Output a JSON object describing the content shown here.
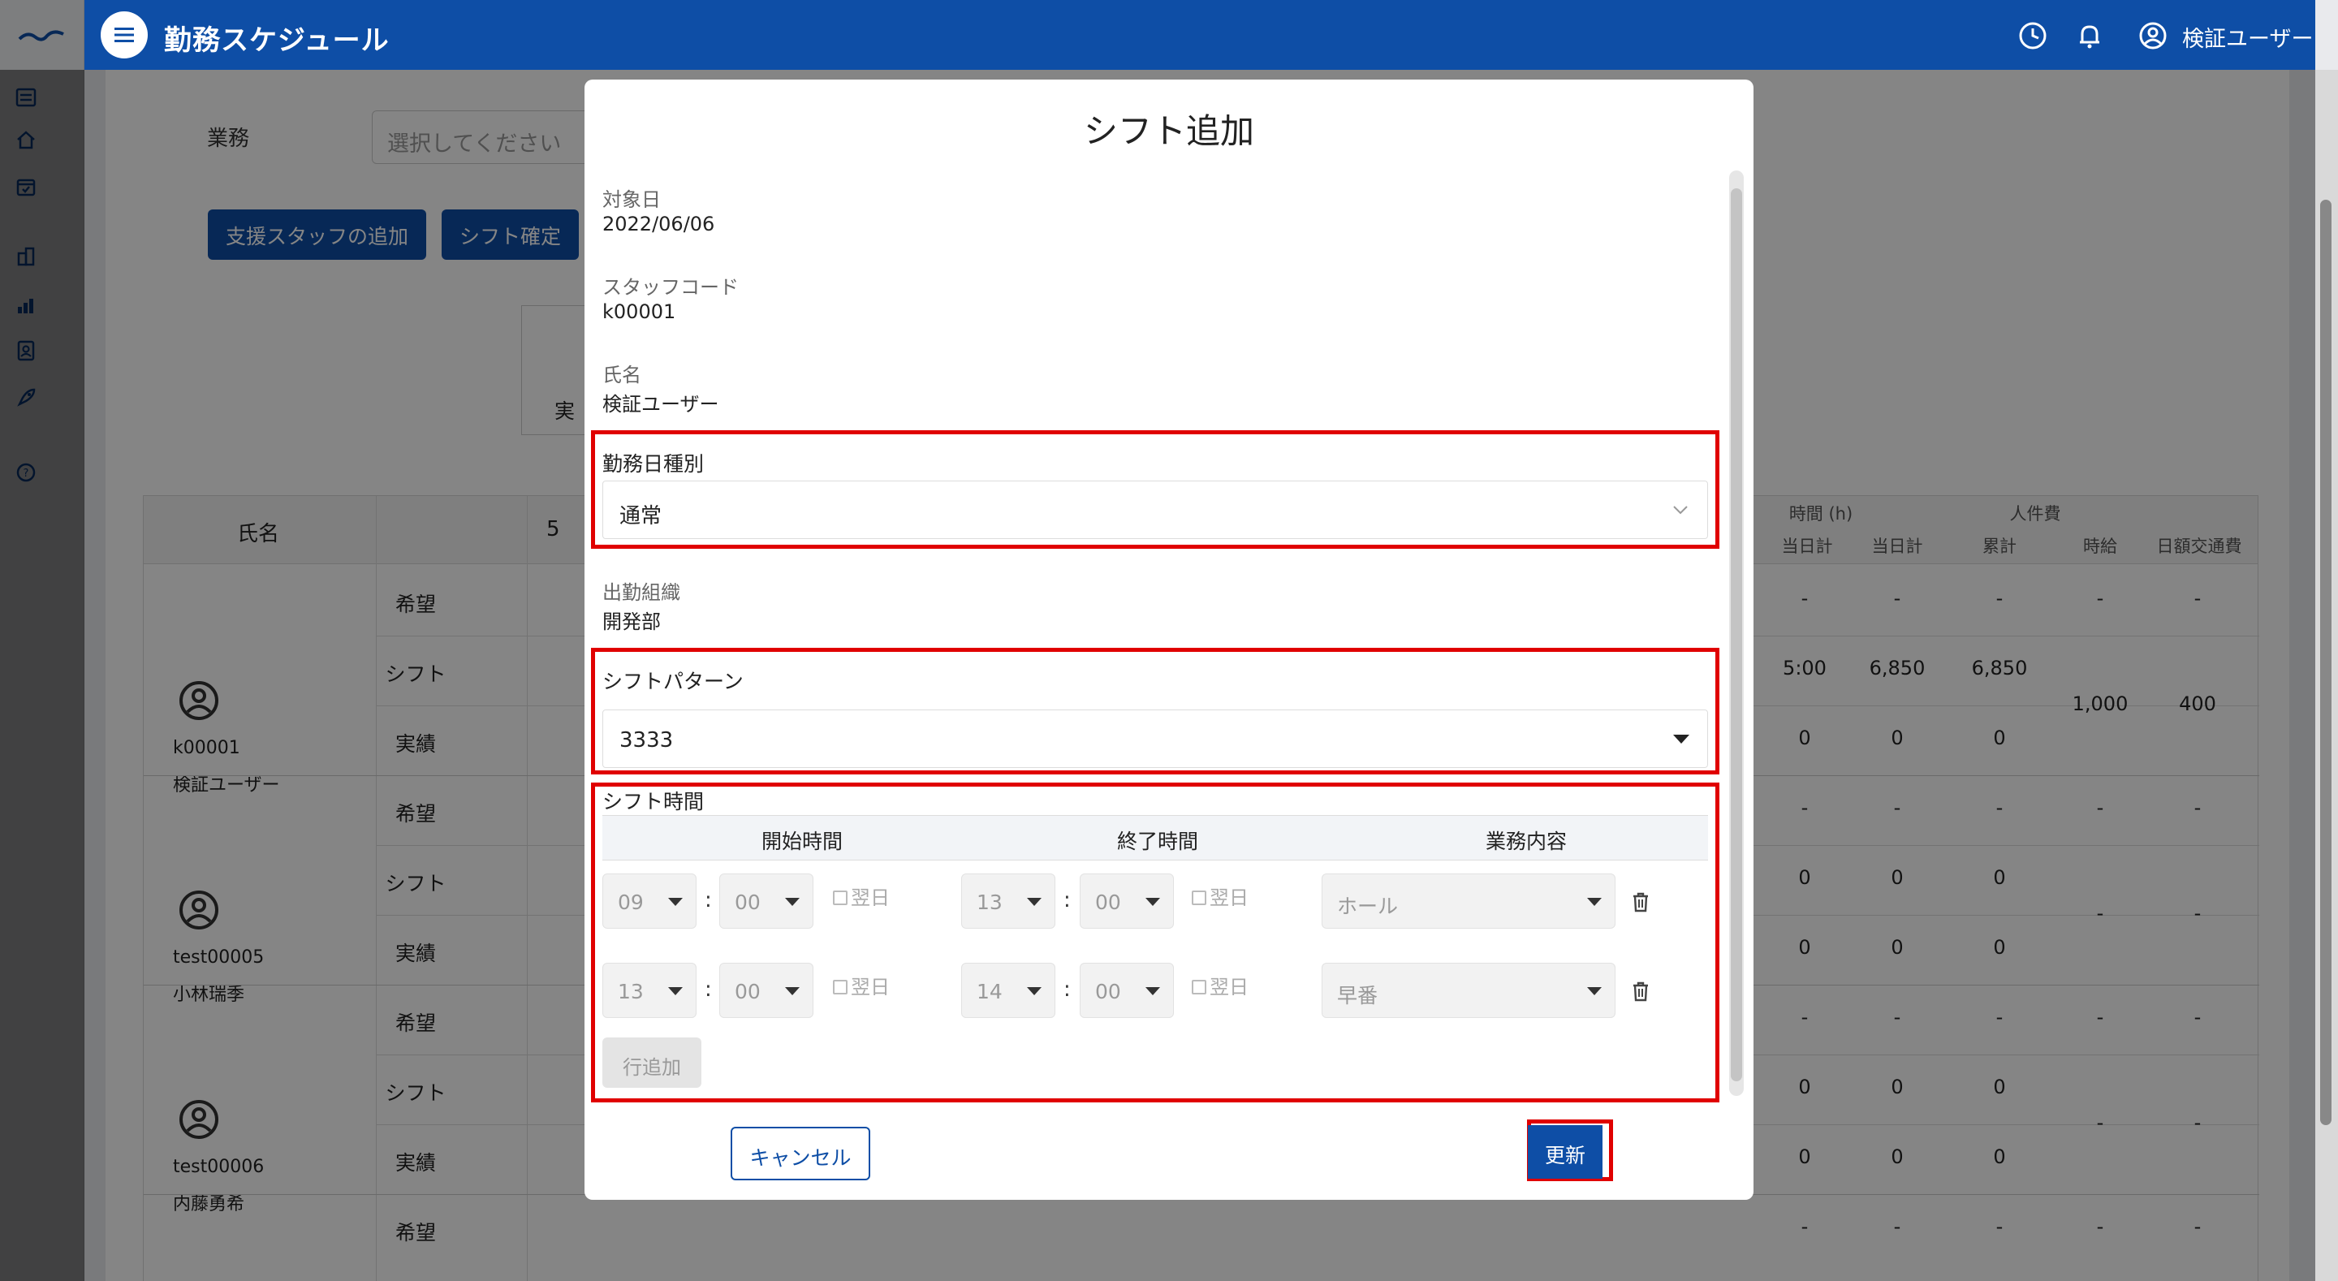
{
  "app": {
    "title": "勤務スケジュール",
    "user_name": "検証ユーザー",
    "icons": [
      "menu-icon",
      "clock-icon",
      "bell-icon",
      "user-circle-icon"
    ]
  },
  "rail": {
    "icons": [
      "logo-icon",
      "list-icon",
      "home-icon",
      "calendar-icon",
      "building-icon",
      "bar-chart-icon",
      "id-card-icon",
      "rocket-icon",
      "help-icon"
    ]
  },
  "background": {
    "work_label": "業務",
    "work_placeholder": "選択してください",
    "add_support_staff": "支援スタッフの追加",
    "confirm_shift": "シフト確定",
    "box_label": "実",
    "grid": {
      "name_header": "氏名",
      "day_header": "5",
      "right_headers": {
        "hours_group": "時間 (h)",
        "labor_group": "人件費",
        "day_total_a": "当日計",
        "day_total_b": "当日計",
        "cumulative": "累計",
        "hourly_wage": "時給",
        "daily_transport": "日額交通費"
      },
      "employees": [
        {
          "code": "k00001",
          "name": "検証ユーザー",
          "rows": [
            "希望",
            "シフト",
            "実績"
          ],
          "hours": [
            "-",
            "5:00",
            "0"
          ],
          "day_total": [
            "-",
            "6,850",
            "0"
          ],
          "cumulative": [
            "-",
            "6,850",
            "0"
          ],
          "hourly": [
            "-",
            "1,000"
          ],
          "transport": [
            "-",
            "400"
          ]
        },
        {
          "code": "test00005",
          "name": "小林瑞季",
          "rows": [
            "希望",
            "シフト",
            "実績"
          ],
          "hours": [
            "-",
            "0",
            "0"
          ],
          "day_total": [
            "-",
            "0",
            "0"
          ],
          "cumulative": [
            "-",
            "0",
            "0"
          ],
          "hourly": [
            "-",
            "-"
          ],
          "transport": [
            "-",
            "-"
          ]
        },
        {
          "code": "test00006",
          "name": "内藤勇希",
          "rows": [
            "希望",
            "シフト",
            "実績"
          ],
          "hours": [
            "-",
            "0",
            "0"
          ],
          "day_total": [
            "-",
            "0",
            "0"
          ],
          "cumulative": [
            "-",
            "0",
            "0"
          ],
          "hourly": [
            "-",
            "-"
          ],
          "transport": [
            "-",
            "-"
          ]
        },
        {
          "code": "",
          "name": "",
          "rows": [
            "希望"
          ],
          "hours": [
            "-"
          ],
          "day_total": [
            "-"
          ],
          "cumulative": [
            "-"
          ],
          "hourly": [
            "-"
          ],
          "transport": [
            "-"
          ]
        }
      ]
    }
  },
  "dialog": {
    "title": "シフト追加",
    "target_date_label": "対象日",
    "target_date": "2022/06/06",
    "staff_code_label": "スタッフコード",
    "staff_code": "k00001",
    "name_label": "氏名",
    "name": "検証ユーザー",
    "work_day_type_label": "勤務日種別",
    "work_day_type": "通常",
    "org_label": "出勤組織",
    "org": "開発部",
    "shift_pattern_label": "シフトパターン",
    "shift_pattern": "3333",
    "shift_time_label": "シフト時間",
    "cols": {
      "start": "開始時間",
      "end": "終了時間",
      "work": "業務内容"
    },
    "colon": ":",
    "next_day": "翌日",
    "rows": [
      {
        "start_h": "09",
        "start_m": "00",
        "end_h": "13",
        "end_m": "00",
        "work": "ホール"
      },
      {
        "start_h": "13",
        "start_m": "00",
        "end_h": "14",
        "end_m": "00",
        "work": "早番"
      }
    ],
    "add_row": "行追加",
    "cancel": "キャンセル",
    "update": "更新"
  },
  "colors": {
    "primary": "#0e4ea6",
    "highlight": "#e00000"
  }
}
